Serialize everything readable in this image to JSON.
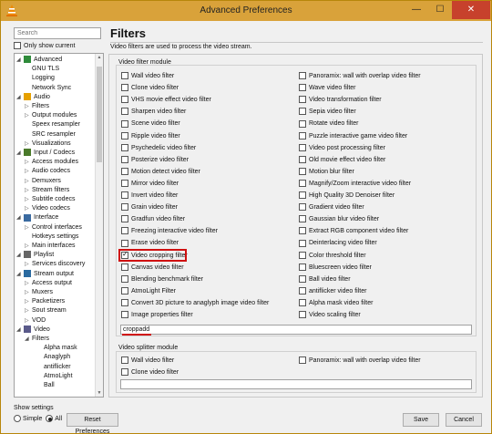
{
  "window": {
    "title": "Advanced Preferences",
    "minimize": "—",
    "maximize": "☐",
    "close": "✕"
  },
  "sidebar": {
    "search_placeholder": "Search",
    "only_show_current": "Only show current",
    "tree": [
      {
        "label": "Advanced",
        "level": 0,
        "expanded": true,
        "icon": "advanced-icon"
      },
      {
        "label": "GNU TLS",
        "level": 1
      },
      {
        "label": "Logging",
        "level": 1
      },
      {
        "label": "Network Sync",
        "level": 1
      },
      {
        "label": "Audio",
        "level": 0,
        "expanded": true,
        "icon": "audio-icon"
      },
      {
        "label": "Filters",
        "level": 1,
        "arrow": true
      },
      {
        "label": "Output modules",
        "level": 1,
        "arrow": true
      },
      {
        "label": "Speex resampler",
        "level": 1
      },
      {
        "label": "SRC resampler",
        "level": 1
      },
      {
        "label": "Visualizations",
        "level": 1,
        "arrow": true
      },
      {
        "label": "Input / Codecs",
        "level": 0,
        "expanded": true,
        "icon": "input-codecs-icon"
      },
      {
        "label": "Access modules",
        "level": 1,
        "arrow": true
      },
      {
        "label": "Audio codecs",
        "level": 1,
        "arrow": true
      },
      {
        "label": "Demuxers",
        "level": 1,
        "arrow": true
      },
      {
        "label": "Stream filters",
        "level": 1,
        "arrow": true
      },
      {
        "label": "Subtitle codecs",
        "level": 1,
        "arrow": true
      },
      {
        "label": "Video codecs",
        "level": 1,
        "arrow": true
      },
      {
        "label": "Interface",
        "level": 0,
        "expanded": true,
        "icon": "interface-icon"
      },
      {
        "label": "Control interfaces",
        "level": 1,
        "arrow": true
      },
      {
        "label": "Hotkeys settings",
        "level": 1
      },
      {
        "label": "Main interfaces",
        "level": 1,
        "arrow": true
      },
      {
        "label": "Playlist",
        "level": 0,
        "expanded": true,
        "icon": "playlist-icon"
      },
      {
        "label": "Services discovery",
        "level": 1,
        "arrow": true
      },
      {
        "label": "Stream output",
        "level": 0,
        "expanded": true,
        "icon": "stream-output-icon"
      },
      {
        "label": "Access output",
        "level": 1,
        "arrow": true
      },
      {
        "label": "Muxers",
        "level": 1,
        "arrow": true
      },
      {
        "label": "Packetizers",
        "level": 1,
        "arrow": true
      },
      {
        "label": "Sout stream",
        "level": 1,
        "arrow": true
      },
      {
        "label": "VOD",
        "level": 1,
        "arrow": true
      },
      {
        "label": "Video",
        "level": 0,
        "expanded": true,
        "icon": "video-icon"
      },
      {
        "label": "Filters",
        "level": 1,
        "expanded": true
      },
      {
        "label": "Alpha mask",
        "level": 2
      },
      {
        "label": "Anaglyph",
        "level": 2
      },
      {
        "label": "antiflicker",
        "level": 2
      },
      {
        "label": "AtmoLight",
        "level": 2
      },
      {
        "label": "Ball",
        "level": 2
      }
    ]
  },
  "main": {
    "title": "Filters",
    "description": "Video filters are used to process the video stream.",
    "filter_module": {
      "label": "Video filter module",
      "left": [
        {
          "label": "Wall video filter",
          "checked": false
        },
        {
          "label": "Clone video filter",
          "checked": false
        },
        {
          "label": "VHS movie effect video filter",
          "checked": false
        },
        {
          "label": "Sharpen video filter",
          "checked": false
        },
        {
          "label": "Scene video filter",
          "checked": false
        },
        {
          "label": "Ripple video filter",
          "checked": false
        },
        {
          "label": "Psychedelic video filter",
          "checked": false
        },
        {
          "label": "Posterize video filter",
          "checked": false
        },
        {
          "label": "Motion detect video filter",
          "checked": false
        },
        {
          "label": "Mirror video filter",
          "checked": false
        },
        {
          "label": "Invert video filter",
          "checked": false
        },
        {
          "label": "Grain video filter",
          "checked": false
        },
        {
          "label": "Gradfun video filter",
          "checked": false
        },
        {
          "label": "Freezing interactive video filter",
          "checked": false
        },
        {
          "label": "Erase video filter",
          "checked": false
        },
        {
          "label": "Video cropping filter",
          "checked": true
        },
        {
          "label": "Canvas video filter",
          "checked": false
        },
        {
          "label": "Blending benchmark filter",
          "checked": false
        },
        {
          "label": "AtmoLight Filter",
          "checked": false
        },
        {
          "label": "Convert 3D picture to anaglyph image video filter",
          "checked": false
        },
        {
          "label": "Image properties filter",
          "checked": false
        }
      ],
      "right": [
        {
          "label": "Panoramix: wall with overlap video filter",
          "checked": false
        },
        {
          "label": "Wave video filter",
          "checked": false
        },
        {
          "label": "Video transformation filter",
          "checked": false
        },
        {
          "label": "Sepia video filter",
          "checked": false
        },
        {
          "label": "Rotate video filter",
          "checked": false
        },
        {
          "label": "Puzzle interactive game video filter",
          "checked": false
        },
        {
          "label": "Video post processing filter",
          "checked": false
        },
        {
          "label": "Old movie effect video filter",
          "checked": false
        },
        {
          "label": "Motion blur filter",
          "checked": false
        },
        {
          "label": "Magnify/Zoom interactive video filter",
          "checked": false
        },
        {
          "label": "High Quality 3D Denoiser filter",
          "checked": false
        },
        {
          "label": "Gradient video filter",
          "checked": false
        },
        {
          "label": "Gaussian blur video filter",
          "checked": false
        },
        {
          "label": "Extract RGB component video filter",
          "checked": false
        },
        {
          "label": "Deinterlacing video filter",
          "checked": false
        },
        {
          "label": "Color threshold filter",
          "checked": false
        },
        {
          "label": "Bluescreen video filter",
          "checked": false
        },
        {
          "label": "Ball video filter",
          "checked": false
        },
        {
          "label": "antiflicker video filter",
          "checked": false
        },
        {
          "label": "Alpha mask video filter",
          "checked": false
        },
        {
          "label": "Video scaling filter",
          "checked": false
        }
      ],
      "value": "croppadd"
    },
    "splitter_module": {
      "label": "Video splitter module",
      "left": [
        {
          "label": "Wall video filter",
          "checked": false
        },
        {
          "label": "Clone video filter",
          "checked": false
        }
      ],
      "right": [
        {
          "label": "Panoramix: wall with overlap video filter",
          "checked": false
        }
      ],
      "value": ""
    }
  },
  "footer": {
    "show_settings": "Show settings",
    "simple": "Simple",
    "all": "All",
    "selected": "all",
    "reset": "Reset Preferences",
    "save": "Save",
    "cancel": "Cancel"
  },
  "colors": {
    "title_bar": "#d9a23a",
    "close_button": "#c7412c",
    "highlight": "#d01010"
  }
}
